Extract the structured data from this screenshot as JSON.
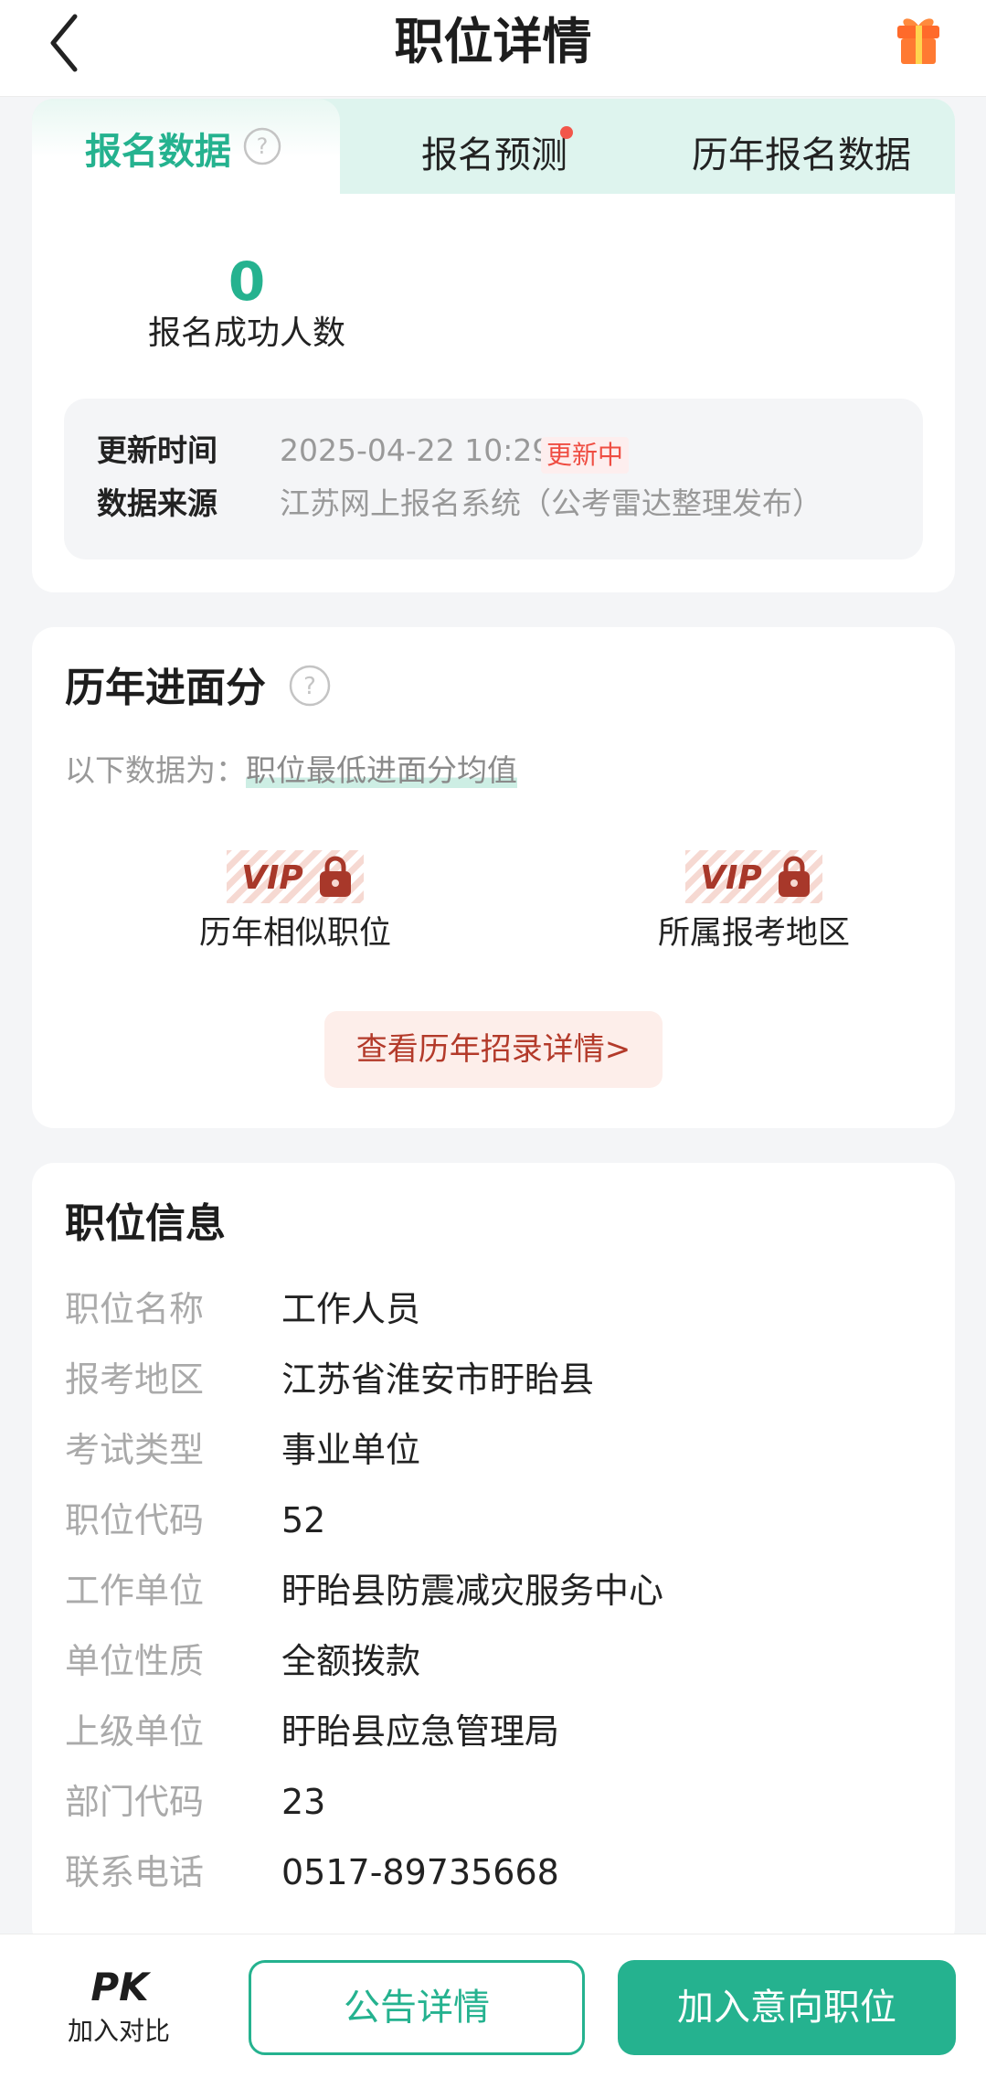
{
  "header": {
    "title": "职位详情",
    "back_icon": "chevron-left-icon",
    "gift_icon": "gift-icon"
  },
  "signup": {
    "tabs": [
      {
        "label": "报名数据",
        "active": true
      },
      {
        "label": "报名预测",
        "has_dot": true
      },
      {
        "label": "历年报名数据"
      }
    ],
    "success_count": "0",
    "success_label": "报名成功人数",
    "update_key": "更新时间",
    "update_value": "2025-04-22 10:29",
    "update_status": "更新中",
    "source_key": "数据来源",
    "source_value": "江苏网上报名系统（公考雷达整理发布）"
  },
  "interview": {
    "title": "历年进面分",
    "note_prefix": "以下数据为：",
    "note_highlight": "职位最低进面分均值",
    "items": [
      {
        "badge": "VIP",
        "label": "历年相似职位"
      },
      {
        "badge": "VIP",
        "label": "所属报考地区"
      }
    ],
    "button_label": "查看历年招录详情>"
  },
  "job_info": {
    "title": "职位信息",
    "rows": [
      {
        "key": "职位名称",
        "value": "工作人员"
      },
      {
        "key": "报考地区",
        "value": "江苏省淮安市盱眙县"
      },
      {
        "key": "考试类型",
        "value": "事业单位"
      },
      {
        "key": "职位代码",
        "value": "52"
      },
      {
        "key": "工作单位",
        "value": "盱眙县防震减灾服务中心"
      },
      {
        "key": "单位性质",
        "value": "全额拨款"
      },
      {
        "key": "上级单位",
        "value": "盱眙县应急管理局"
      },
      {
        "key": "部门代码",
        "value": "23"
      },
      {
        "key": "联系电话",
        "value": "0517-89735668"
      }
    ]
  },
  "bottom_bar": {
    "pk_label": "PK",
    "compare_label": "加入对比",
    "notice_button": "公告详情",
    "intent_button": "加入意向职位"
  },
  "colors": {
    "accent": "#25b28f",
    "alert": "#ef4d42",
    "vip": "#a8382a"
  }
}
